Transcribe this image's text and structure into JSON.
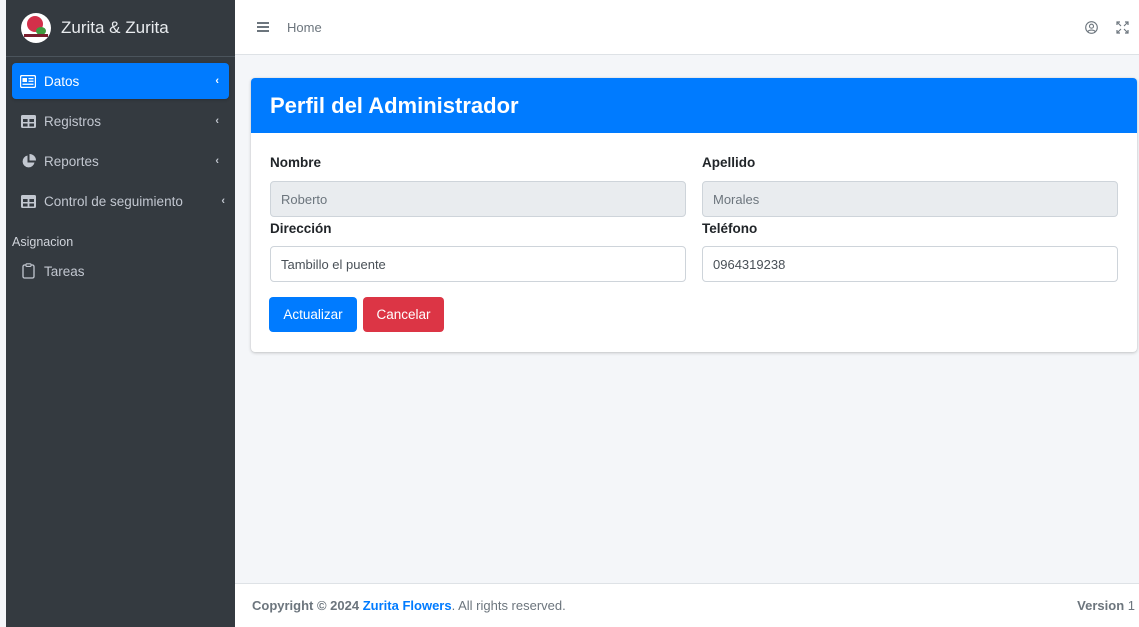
{
  "brand": {
    "name": "Zurita & Zurita"
  },
  "sidebar": {
    "items": [
      {
        "label": "Datos",
        "icon": "id-card-icon",
        "active": true
      },
      {
        "label": "Registros",
        "icon": "table-icon"
      },
      {
        "label": "Reportes",
        "icon": "pie-chart-icon"
      },
      {
        "label": "Control de seguimiento",
        "icon": "table-icon"
      }
    ],
    "header": "Asignacion",
    "extra_items": [
      {
        "label": "Tareas",
        "icon": "clipboard-icon"
      }
    ]
  },
  "topbar": {
    "home_label": "Home"
  },
  "profile": {
    "title": "Perfil del Administrador",
    "nombre_label": "Nombre",
    "nombre_value": "Roberto",
    "apellido_label": "Apellido",
    "apellido_value": "Morales",
    "direccion_label": "Dirección",
    "direccion_value": "Tambillo el puente",
    "telefono_label": "Teléfono",
    "telefono_value": "0964319238",
    "update_label": "Actualizar",
    "cancel_label": "Cancelar"
  },
  "footer": {
    "copyright_prefix": "Copyright © 2024 ",
    "company": "Zurita Flowers",
    "suffix": ". All rights reserved.",
    "version_label": "Version",
    "version_value": "1"
  },
  "colors": {
    "primary": "#007bff",
    "danger": "#dc3545",
    "sidebar": "#343a40"
  }
}
